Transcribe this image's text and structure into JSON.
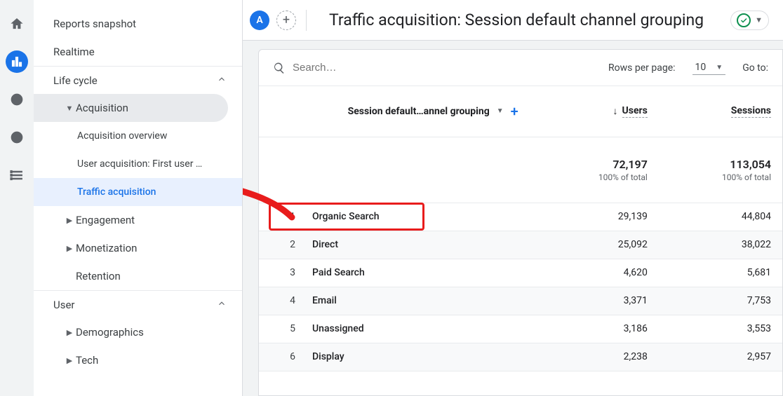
{
  "rail": {
    "home": "home-icon",
    "reports": "reports-icon",
    "explore": "explore-icon",
    "advertising": "advertising-icon",
    "configure": "configure-icon"
  },
  "nav": {
    "top": [
      {
        "label": "Reports snapshot"
      },
      {
        "label": "Realtime"
      }
    ],
    "sections": [
      {
        "label": "Life cycle",
        "items": [
          {
            "label": "Acquisition",
            "expanded": true,
            "children": [
              {
                "label": "Acquisition overview"
              },
              {
                "label": "User acquisition: First user …"
              },
              {
                "label": "Traffic acquisition",
                "selected": true
              }
            ]
          },
          {
            "label": "Engagement",
            "expanded": false
          },
          {
            "label": "Monetization",
            "expanded": false
          },
          {
            "label": "Retention",
            "leaf": true
          }
        ]
      },
      {
        "label": "User",
        "items": [
          {
            "label": "Demographics",
            "expanded": false
          },
          {
            "label": "Tech",
            "expanded": false
          }
        ]
      }
    ]
  },
  "header": {
    "segment_letter": "A",
    "title": "Traffic acquisition: Session default channel grouping"
  },
  "toolbar": {
    "search_placeholder": "Search…",
    "rows_label": "Rows per page:",
    "rows_value": "10",
    "goto_label": "Go to:"
  },
  "table": {
    "dimension_label": "Session default…annel grouping",
    "columns": [
      {
        "label": "Users",
        "sorted": true
      },
      {
        "label": "Sessions"
      }
    ],
    "totals": {
      "users": "72,197",
      "users_sub": "100% of total",
      "sessions": "113,054",
      "sessions_sub": "100% of total"
    },
    "rows": [
      {
        "idx": "1",
        "name": "Organic Search",
        "users": "29,139",
        "sessions": "44,804"
      },
      {
        "idx": "2",
        "name": "Direct",
        "users": "25,092",
        "sessions": "38,022"
      },
      {
        "idx": "3",
        "name": "Paid Search",
        "users": "4,620",
        "sessions": "5,681"
      },
      {
        "idx": "4",
        "name": "Email",
        "users": "3,371",
        "sessions": "7,753"
      },
      {
        "idx": "5",
        "name": "Unassigned",
        "users": "3,186",
        "sessions": "3,553"
      },
      {
        "idx": "6",
        "name": "Display",
        "users": "2,238",
        "sessions": "2,957"
      }
    ]
  },
  "annotation": {
    "highlight_row_index": 0
  }
}
